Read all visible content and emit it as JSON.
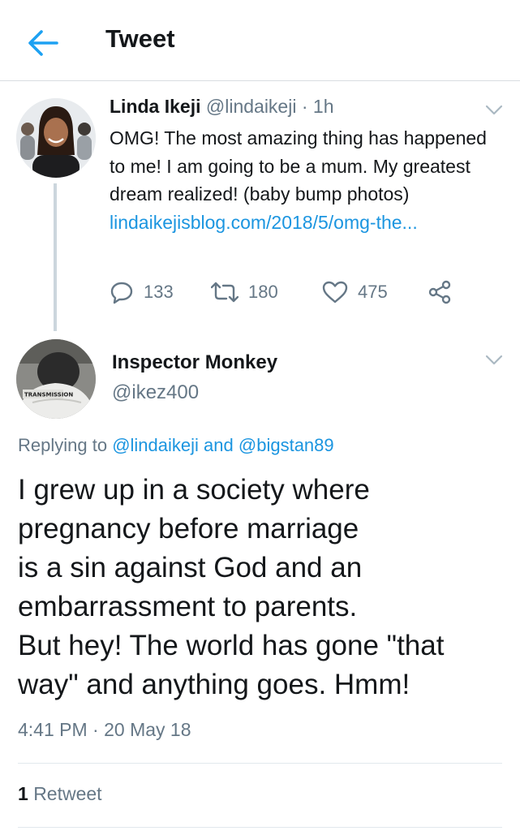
{
  "header": {
    "title": "Tweet"
  },
  "parent_tweet": {
    "name": "Linda Ikeji",
    "handle": "@lindaikeji",
    "separator": "·",
    "time": "1h",
    "text_before_link": "OMG! The most amazing thing has happened to me! I am going to be a mum. My greatest dream realized! (baby bump photos)",
    "link_text": "lindaikejisblog.com/​2018/5/omg-the...",
    "replies": "133",
    "retweets": "180",
    "likes": "475"
  },
  "main_tweet": {
    "name": "Inspector Monkey",
    "handle": "@ikez400",
    "avatar_caption": "TRANSMISSION",
    "replying_prefix": "Replying to",
    "reply_user1": "@lindaikeji",
    "reply_and": "and",
    "reply_user2": "@bigstan89",
    "lines": [
      "I grew up in a society where",
      "pregnancy before marriage",
      "is a sin against God and an",
      "embarrassment to parents.",
      "But hey! The world has gone \"that",
      "way\" and anything goes. Hmm!"
    ],
    "time": "4:41 PM",
    "separator": "·",
    "date": "20 May 18",
    "retweet_count": "1",
    "retweet_label": "Retweet"
  },
  "colors": {
    "accent": "#1da1f2",
    "link": "#1b95e0",
    "muted": "#657786",
    "text": "#14171a",
    "thread_line": "#ccd6dd"
  },
  "icons": [
    "back-arrow-icon",
    "chevron-down-icon",
    "reply-icon",
    "retweet-icon",
    "like-icon",
    "share-icon"
  ]
}
